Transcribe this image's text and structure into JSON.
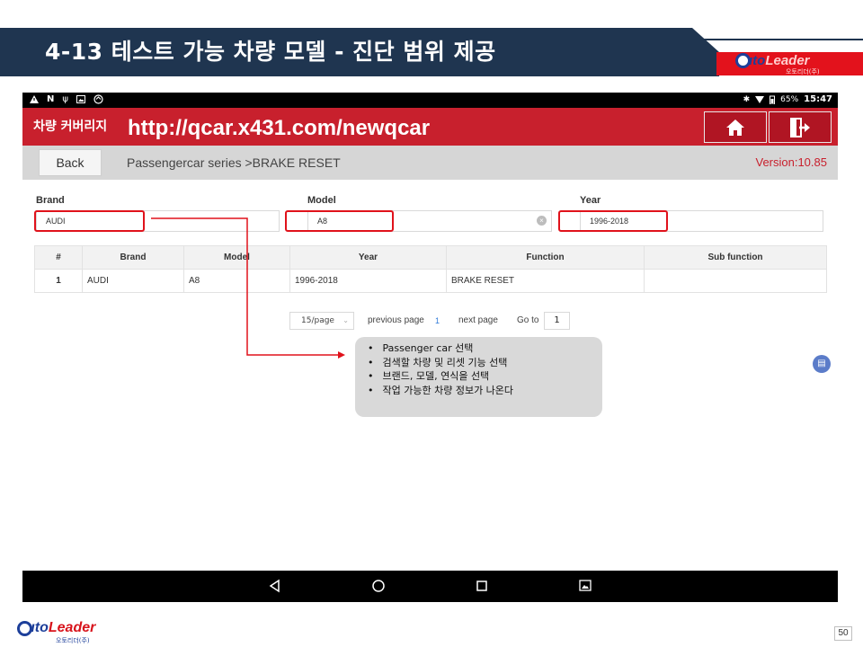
{
  "slide": {
    "title": "4-13  테스트 가능 차량 모델 - 진단 범위 제공",
    "page_number": "50"
  },
  "logo": {
    "word_start": "uto",
    "word_end": "Leader",
    "sub": "오토리더(주)"
  },
  "status_bar": {
    "battery": "65%",
    "time": "15:47"
  },
  "app_bar": {
    "title": "차량 커버리지",
    "url": "http://qcar.x431.com/newqcar"
  },
  "crumb_bar": {
    "back_label": "Back",
    "breadcrumb": "Passengercar series >BRAKE RESET",
    "version": "Version:10.85"
  },
  "filters": {
    "brand_label": "Brand",
    "brand_value": "AUDI",
    "model_label": "Model",
    "model_value": "A8",
    "year_label": "Year",
    "year_value": "1996-2018"
  },
  "table": {
    "headers": [
      "#",
      "Brand",
      "Model",
      "Year",
      "Function",
      "Sub function"
    ],
    "rows": [
      [
        "1",
        "AUDI",
        "A8",
        "1996-2018",
        "BRAKE RESET",
        ""
      ]
    ]
  },
  "pagination": {
    "page_size": "15/page",
    "previous": "previous page",
    "current": "1",
    "next": "next page",
    "goto_label": "Go to",
    "goto_value": "1"
  },
  "note": {
    "items": [
      "Passenger car 선택",
      "검색할 차량 및 리셋 기능 선택",
      "브랜드, 모델, 연식을 선택",
      "작업 가능한 차량 정보가 나온다"
    ]
  },
  "colors": {
    "banner": "#1f3550",
    "app_red": "#c8202d",
    "highlight": "#e0121b"
  }
}
